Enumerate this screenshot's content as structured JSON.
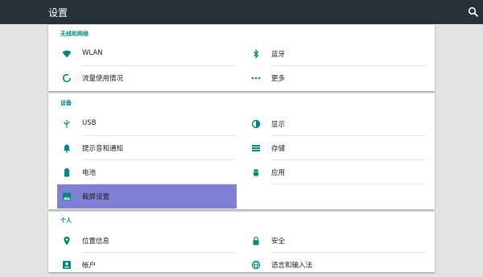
{
  "header": {
    "title": "设置",
    "search_icon": "search-icon"
  },
  "colors": {
    "topbar": "#263238",
    "accent": "#00897b",
    "selected": "#7f7fd5"
  },
  "sections": [
    {
      "title": "无线和网络",
      "items": [
        {
          "label": "WLAN",
          "icon": "wifi-icon"
        },
        {
          "label": "蓝牙",
          "icon": "bluetooth-icon"
        },
        {
          "label": "流量使用情况",
          "icon": "data-usage-icon"
        },
        {
          "label": "更多",
          "icon": "more-icon"
        }
      ]
    },
    {
      "title": "设备",
      "items": [
        {
          "label": "USB",
          "icon": "usb-icon"
        },
        {
          "label": "显示",
          "icon": "display-icon"
        },
        {
          "label": "提示音和通知",
          "icon": "bell-icon"
        },
        {
          "label": "存储",
          "icon": "storage-icon"
        },
        {
          "label": "电池",
          "icon": "battery-icon"
        },
        {
          "label": "应用",
          "icon": "android-icon"
        },
        {
          "label": "截屏设置",
          "icon": "image-icon",
          "selected": true
        }
      ]
    },
    {
      "title": "个人",
      "items": [
        {
          "label": "位置信息",
          "icon": "location-icon"
        },
        {
          "label": "安全",
          "icon": "lock-icon"
        },
        {
          "label": "帐户",
          "icon": "account-icon"
        },
        {
          "label": "语言和输入法",
          "icon": "globe-icon"
        }
      ]
    }
  ]
}
